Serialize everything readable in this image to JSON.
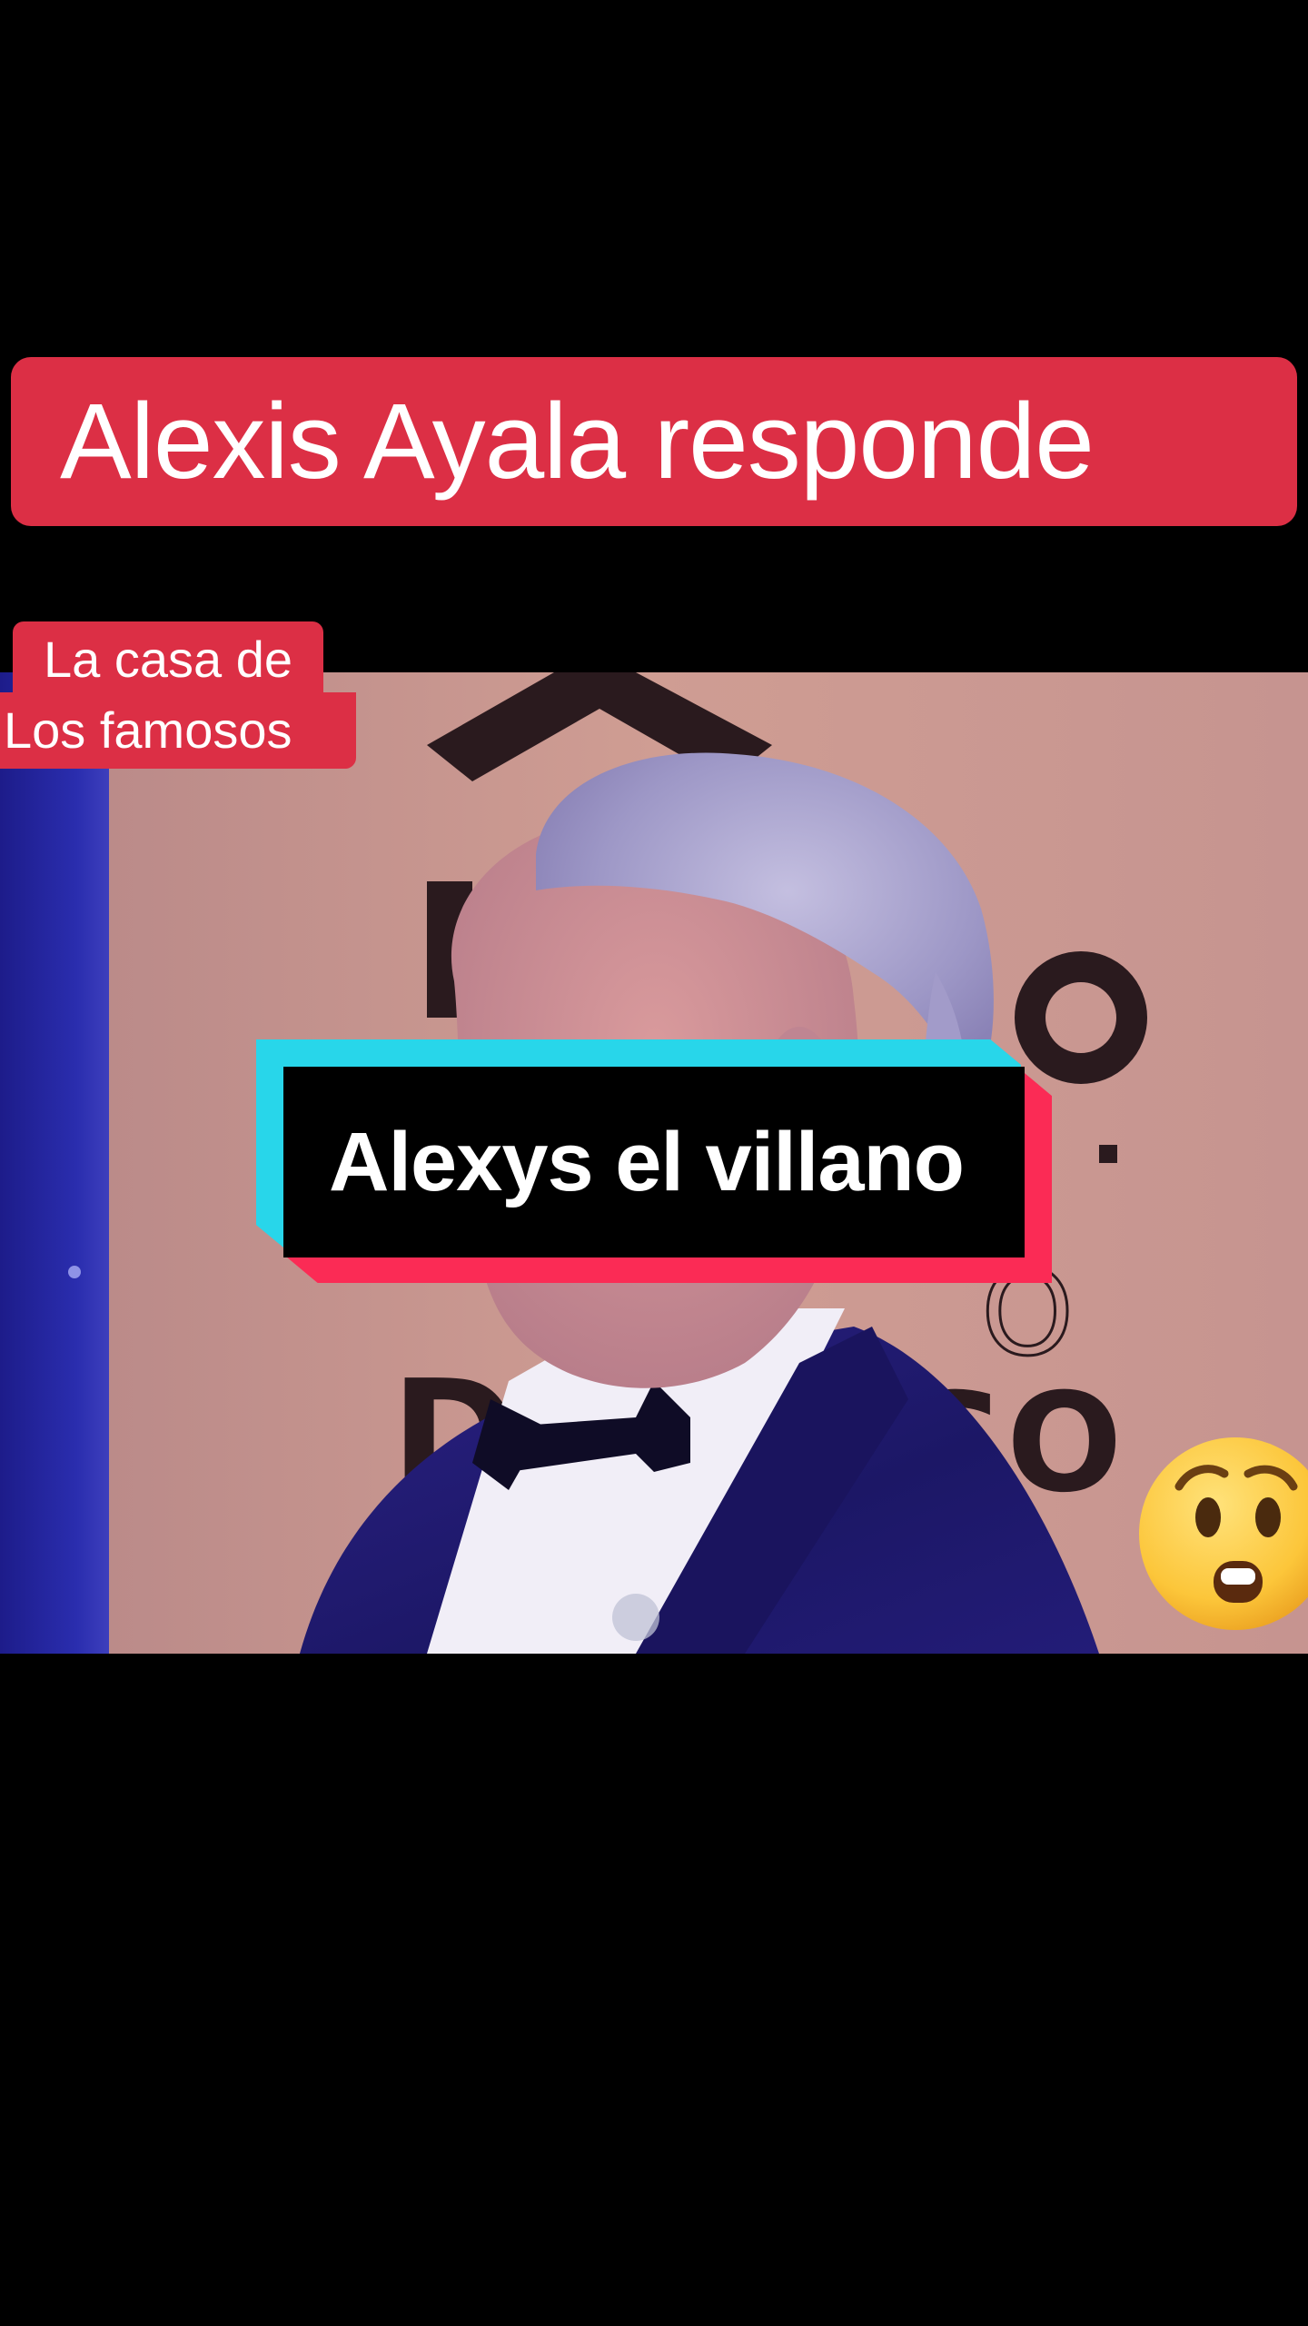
{
  "headline": {
    "text": "Alexis Ayala responde",
    "color": "#dc2f45"
  },
  "caption": {
    "line1": "La casa de",
    "line2": "Los famosos",
    "color": "#dc2f45"
  },
  "title_box": {
    "text": "Alexys el villano",
    "colors": {
      "cyan": "#28d6ea",
      "red": "#fb2b55",
      "fill": "#000000"
    }
  },
  "video": {
    "backdrop_letters": [
      "S",
      "O",
      "D",
      "SO"
    ]
  },
  "emoji": {
    "icon": "hushed-face-emoji"
  }
}
